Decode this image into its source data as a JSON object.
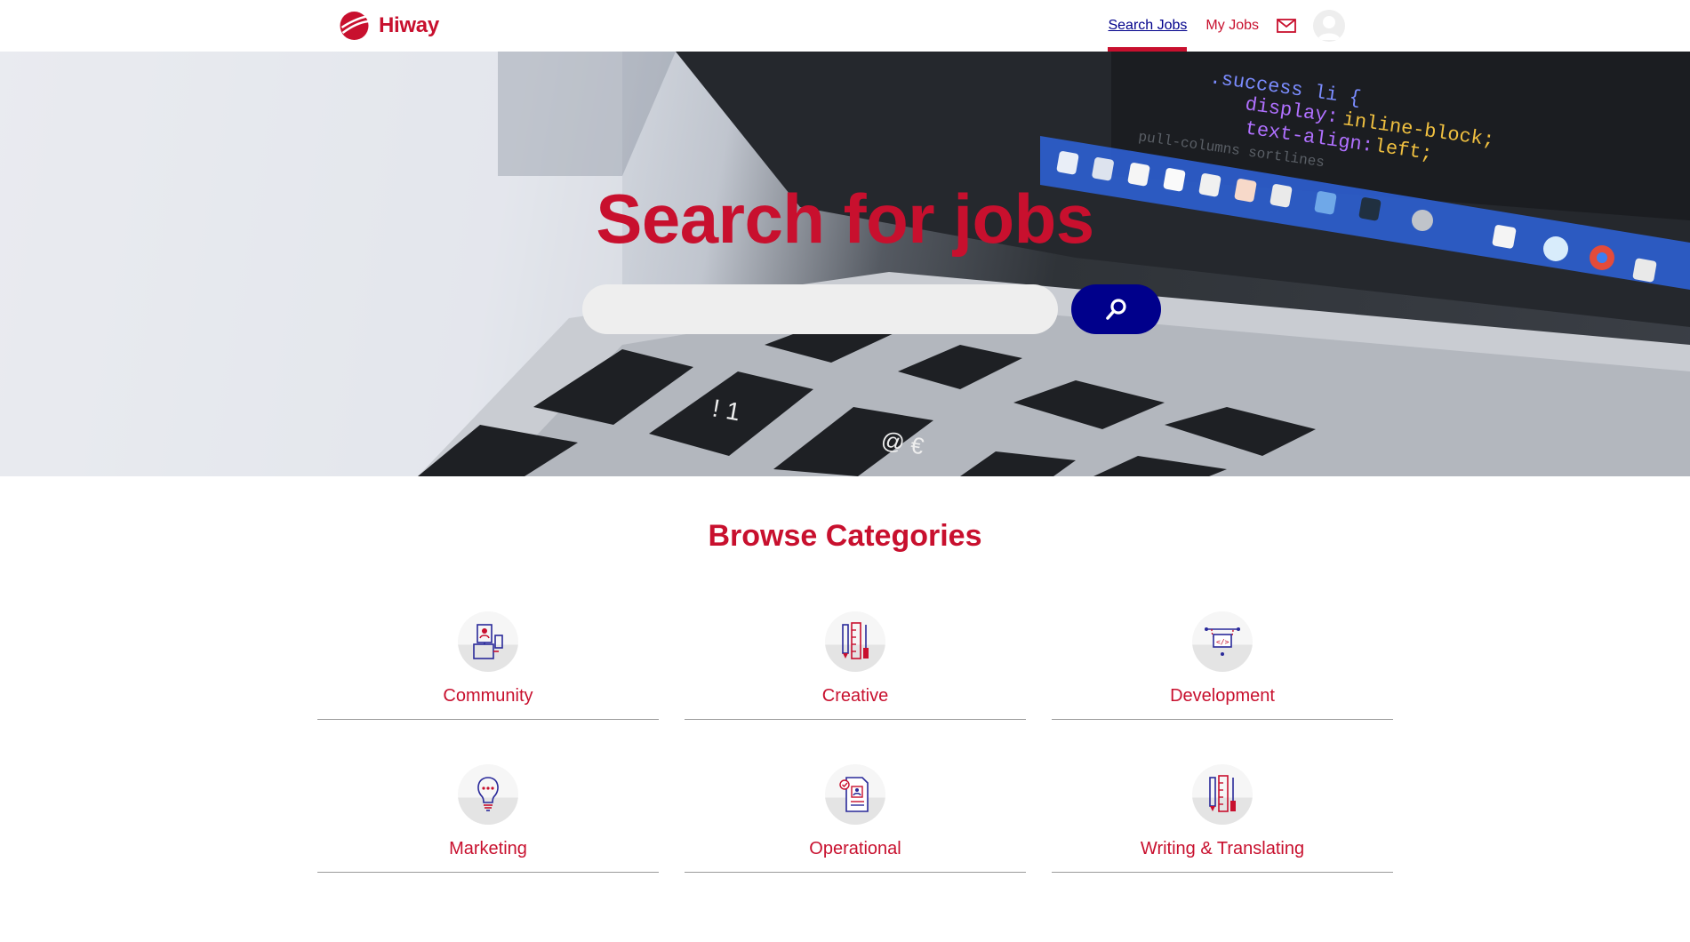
{
  "header": {
    "brand": "Hiway",
    "nav": [
      {
        "label": "Search Jobs",
        "active": true
      },
      {
        "label": "My Jobs",
        "active": false
      }
    ],
    "mail_icon": "mail-icon",
    "avatar_icon": "user-avatar-icon"
  },
  "hero": {
    "title": "Search for jobs",
    "search": {
      "value": "",
      "placeholder": ""
    },
    "search_button_icon": "search-icon",
    "background_image": "laptop-keyboard-with-code-screen"
  },
  "categories": {
    "title": "Browse Categories",
    "items": [
      {
        "label": "Community",
        "icon": "community-devices-icon"
      },
      {
        "label": "Creative",
        "icon": "pencil-ruler-icon"
      },
      {
        "label": "Development",
        "icon": "code-window-icon"
      },
      {
        "label": "Marketing",
        "icon": "lightbulb-icon"
      },
      {
        "label": "Operational",
        "icon": "document-profile-icon"
      },
      {
        "label": "Writing & Translating",
        "icon": "pencil-ruler-icon"
      }
    ]
  },
  "colors": {
    "brand_red": "#c8102e",
    "brand_navy": "#00008b",
    "search_field": "#eeeeee"
  }
}
